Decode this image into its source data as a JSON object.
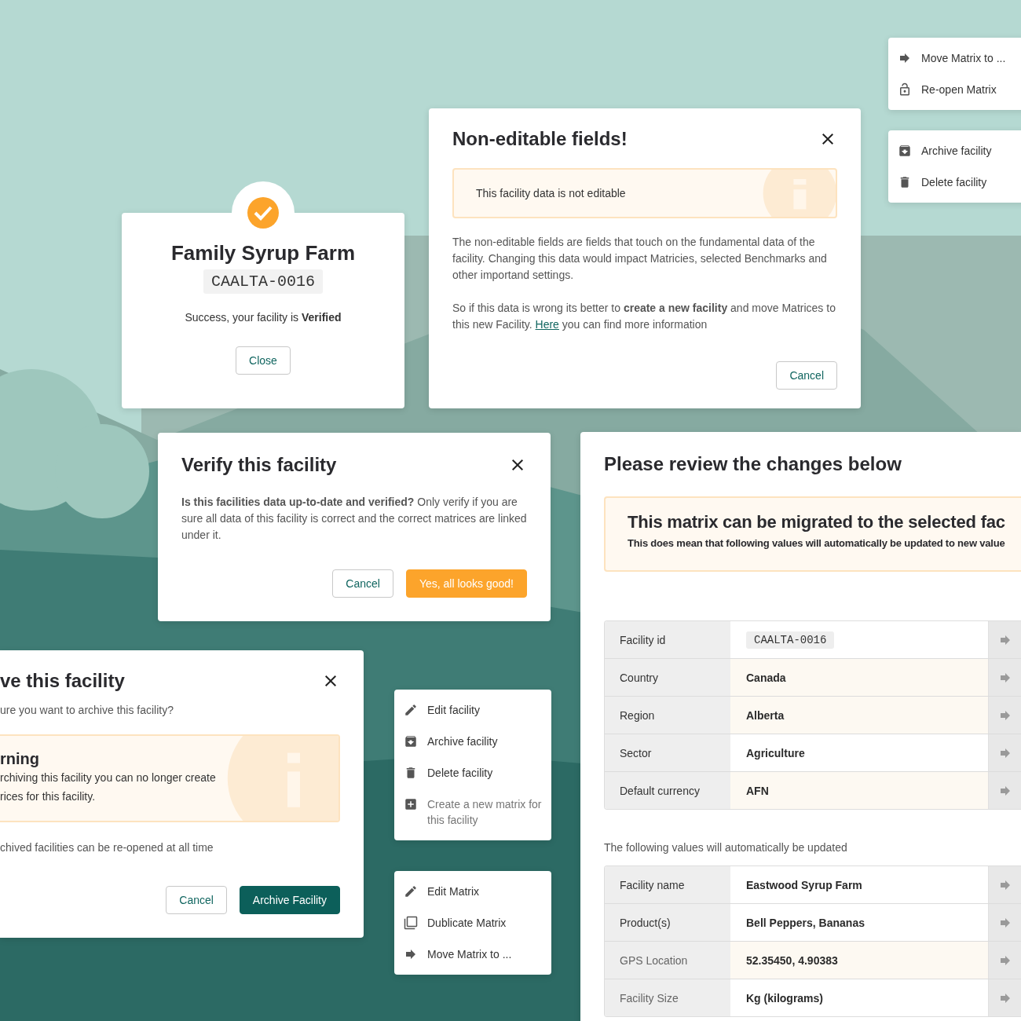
{
  "menus": [
    {
      "items": [
        {
          "kind": "arrow",
          "label": "Move Matrix to ...",
          "disabled": false
        },
        {
          "kind": "lock",
          "label": "Re-open Matrix",
          "disabled": false
        }
      ]
    },
    {
      "items": [
        {
          "kind": "archive",
          "label": "Archive facility",
          "disabled": false
        },
        {
          "kind": "trash",
          "label": "Delete facility",
          "disabled": false
        }
      ]
    },
    {
      "items": [
        {
          "kind": "pencil",
          "label": "Edit facility",
          "disabled": false
        },
        {
          "kind": "archive",
          "label": "Archive facility",
          "disabled": false
        },
        {
          "kind": "trash",
          "label": "Delete facility",
          "disabled": false
        },
        {
          "kind": "plus",
          "label": "Create a new matrix for this facility",
          "disabled": true
        }
      ]
    },
    {
      "items": [
        {
          "kind": "pencil",
          "label": "Edit Matrix",
          "disabled": false
        },
        {
          "kind": "copy",
          "label": "Dublicate Matrix",
          "disabled": false
        },
        {
          "kind": "arrow",
          "label": "Move Matrix to ...",
          "disabled": false
        }
      ]
    }
  ],
  "success_dialog": {
    "title": "Family Syrup Farm",
    "code": "CAALTA-0016",
    "message": "Success, your facility is **Verified**",
    "button": "Close"
  },
  "non_editable_dialog": {
    "title": "Non-editable fields!",
    "notice": "This facility data is not editable",
    "paragraph": "The non-editable fields are fields that touch on the fundamental data of the facility. Changing this data would impact Matricies, selected Benchmarks and other importand settings.",
    "advice": "So if this data is wrong its better to **create a new facility** and move Matrices to this new Facility.",
    "link": "Here",
    "advice_end": "you can find more information",
    "buttons": [
      {
        "label": "Cancel",
        "kind": "secondary"
      }
    ]
  },
  "verify_dialog": {
    "title": "Verify this facility",
    "body": "**Is this facilities data up-to-date and verified?** Only verify if you are sure all data of this facility is correct and the correct matrices are linked under it.",
    "buttons": [
      {
        "label": "Cancel",
        "kind": "secondary"
      },
      {
        "label": "Yes, all looks good!",
        "kind": "warning"
      }
    ]
  },
  "archive_dialog": {
    "title": "ve this facility",
    "question": "ure you want to archive this facility?",
    "warning": {
      "title": "rning",
      "lines": [
        "rchiving this facility you can no longer create",
        "rices for this facility."
      ]
    },
    "note": "chived facilities can be re-opened at all time",
    "buttons": [
      {
        "label": "Cancel",
        "kind": "secondary"
      },
      {
        "label": "Archive Facility",
        "kind": "primary"
      }
    ]
  },
  "review_panel": {
    "title": "Please review the changes below",
    "notice": {
      "title": "This matrix can be migrated to the selected fac",
      "subtitle": "This does mean that following values will automatically be updated to new value"
    },
    "fixed_rows": [
      {
        "label": "Facility id",
        "value": "CAALTA-0016",
        "kind": "code",
        "highlighted": false,
        "muted": false
      },
      {
        "label": "Country",
        "value": "Canada",
        "kind": "text",
        "highlighted": true,
        "muted": false
      },
      {
        "label": "Region",
        "value": "Alberta",
        "kind": "text",
        "highlighted": true,
        "muted": false
      },
      {
        "label": "Sector",
        "value": "Agriculture",
        "kind": "text",
        "highlighted": false,
        "muted": false
      },
      {
        "label": "Default currency",
        "value": "AFN",
        "kind": "text",
        "highlighted": true,
        "muted": false
      }
    ],
    "updated_label": "The following values will automatically be updated",
    "updated_rows": [
      {
        "label": "Facility name",
        "value": "Eastwood Syrup Farm",
        "kind": "text",
        "highlighted": false,
        "muted": false
      },
      {
        "label": "Product(s)",
        "value": "Bell Peppers, Bananas",
        "kind": "text",
        "highlighted": false,
        "muted": false
      },
      {
        "label": "GPS Location",
        "value": "52.35450, 4.90383",
        "kind": "text",
        "highlighted": true,
        "muted": true
      },
      {
        "label": "Facility Size",
        "value": "Kg (kilograms)",
        "kind": "text",
        "highlighted": false,
        "muted": true
      }
    ]
  }
}
